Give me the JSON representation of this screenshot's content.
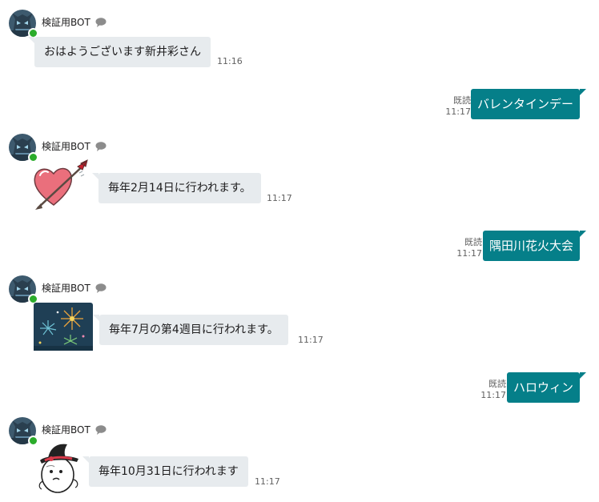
{
  "bot": {
    "name": "検証用BOT",
    "avatar_icon": "bot-avatar-icon",
    "status": "online",
    "status_color": "#2bac2b"
  },
  "colors": {
    "outgoing_bubble": "#057f89",
    "incoming_bubble": "#e7ebee"
  },
  "messages": [
    {
      "direction": "in",
      "text": "おはようございます新井彩さん",
      "time": "11:16"
    },
    {
      "direction": "out",
      "text": "バレンタインデー",
      "read": "既読",
      "time": "11:17"
    },
    {
      "direction": "in",
      "sticker": "heart-arrow-icon",
      "text": "毎年2月14日に行われます。",
      "time": "11:17"
    },
    {
      "direction": "out",
      "text": "隅田川花火大会",
      "read": "既読",
      "time": "11:17"
    },
    {
      "direction": "in",
      "sticker": "fireworks-icon",
      "text": "毎年7月の第4週目に行われます。",
      "time": "11:17"
    },
    {
      "direction": "out",
      "text": "ハロウィン",
      "read": "既読",
      "time": "11:17"
    },
    {
      "direction": "in",
      "sticker": "witch-hat-character-icon",
      "text": "毎年10月31日に行われます",
      "time": "11:17"
    }
  ]
}
